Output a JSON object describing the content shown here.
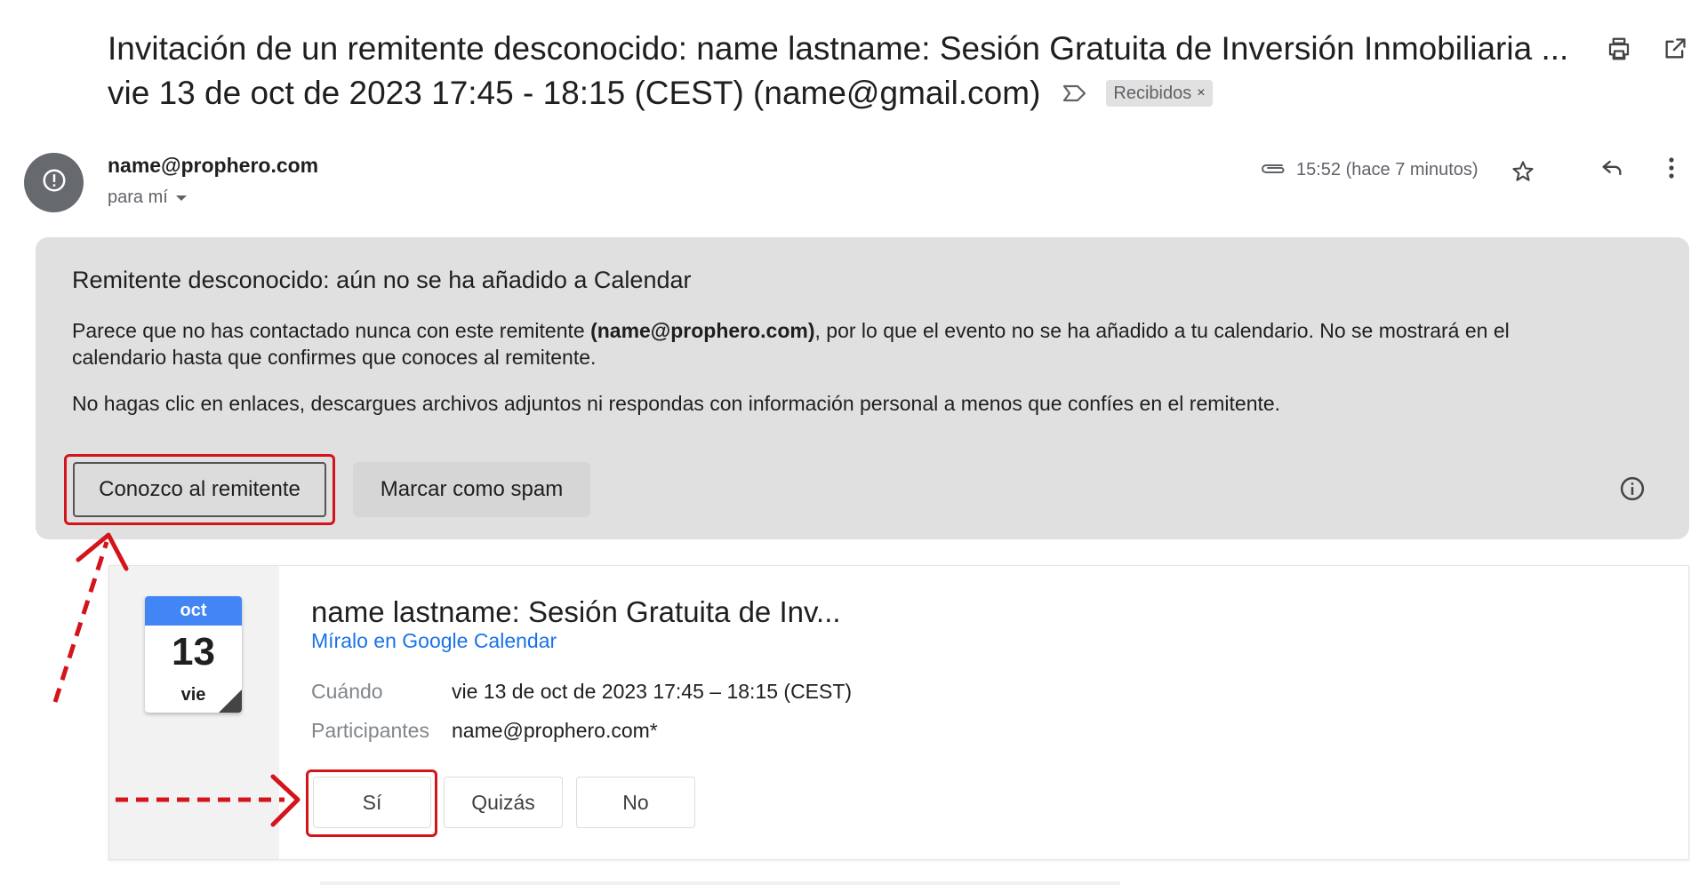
{
  "email": {
    "subject_line1": "Invitación de un remitente desconocido: name lastname: Sesión Gratuita de Inversión Inmobiliaria ...",
    "subject_line2": "vie 13 de oct de 2023 17:45 - 18:15 (CEST) (name@gmail.com)",
    "label": "Recibidos",
    "label_remove": "×",
    "sender": "name@prophero.com",
    "recipient": "para mí",
    "time": "15:52 (hace 7 minutos)"
  },
  "icons": {
    "print": "print-icon",
    "open_new": "open-in-new-icon",
    "important": "label-important-icon",
    "avatar": "warning-icon",
    "attachment": "attachment-icon",
    "star": "star-icon",
    "reply": "reply-icon",
    "more": "more-vert-icon",
    "info": "info-icon"
  },
  "banner": {
    "title": "Remitente desconocido: aún no se ha añadido a Calendar",
    "p1_before": "Parece que no has contactado nunca con este remitente ",
    "p1_bold": "(name@prophero.com)",
    "p1_after": ", por lo que el evento no se ha añadido a tu calendario. No se mostrará en el calendario hasta que confirmes que conoces al remitente.",
    "p2": "No hagas clic en enlaces, descargues archivos adjuntos ni respondas con información personal a menos que confíes en el remitente.",
    "know_sender_button": "Conozco al remitente",
    "spam_button": "Marcar como spam"
  },
  "event": {
    "month": "oct",
    "day": "13",
    "weekday": "vie",
    "title": "name lastname: Sesión Gratuita de Inv...",
    "calendar_link": "Míralo en Google Calendar",
    "when_label": "Cuándo",
    "when_value": "vie 13 de oct de 2023 17:45 – 18:15 (CEST)",
    "participants_label": "Participantes",
    "participants_value": "name@prophero.com*",
    "rsvp_yes": "Sí",
    "rsvp_maybe": "Quizás",
    "rsvp_no": "No"
  },
  "colors": {
    "annotation_red": "#d4141b",
    "link_blue": "#1a73e8",
    "calendar_blue": "#4285f4",
    "banner_gray": "#e0e0e0"
  }
}
